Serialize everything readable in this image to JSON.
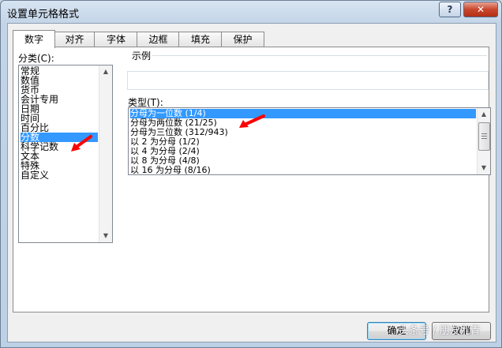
{
  "window": {
    "title": "设置单元格格式"
  },
  "titlebar": {
    "help_label": "?",
    "close_label": "✕"
  },
  "tabs": [
    {
      "label": "数字",
      "active": true
    },
    {
      "label": "对齐"
    },
    {
      "label": "字体"
    },
    {
      "label": "边框"
    },
    {
      "label": "填充"
    },
    {
      "label": "保护"
    }
  ],
  "category": {
    "label": "分类(C):",
    "items": [
      "常规",
      "数值",
      "货币",
      "会计专用",
      "日期",
      "时间",
      "百分比",
      "分数",
      "科学记数",
      "文本",
      "特殊",
      "自定义"
    ],
    "selected_index": 7
  },
  "sample": {
    "label": "示例",
    "value": ""
  },
  "type": {
    "label": "类型(T):",
    "items": [
      "分母为一位数 (1/4)",
      "分母为两位数 (21/25)",
      "分母为三位数 (312/943)",
      "以 2 为分母 (1/2)",
      "以 4 为分母 (2/4)",
      "以 8 为分母 (4/8)",
      "以 16 为分母 (8/16)"
    ],
    "selected_index": 0
  },
  "buttons": {
    "ok_label": "确定",
    "cancel_label": "取消"
  },
  "watermark": "头条号 / 朋友九青",
  "colors": {
    "selection": "#3399ff",
    "annotation_arrow": "#ff0000",
    "close_button": "#c9462c"
  }
}
